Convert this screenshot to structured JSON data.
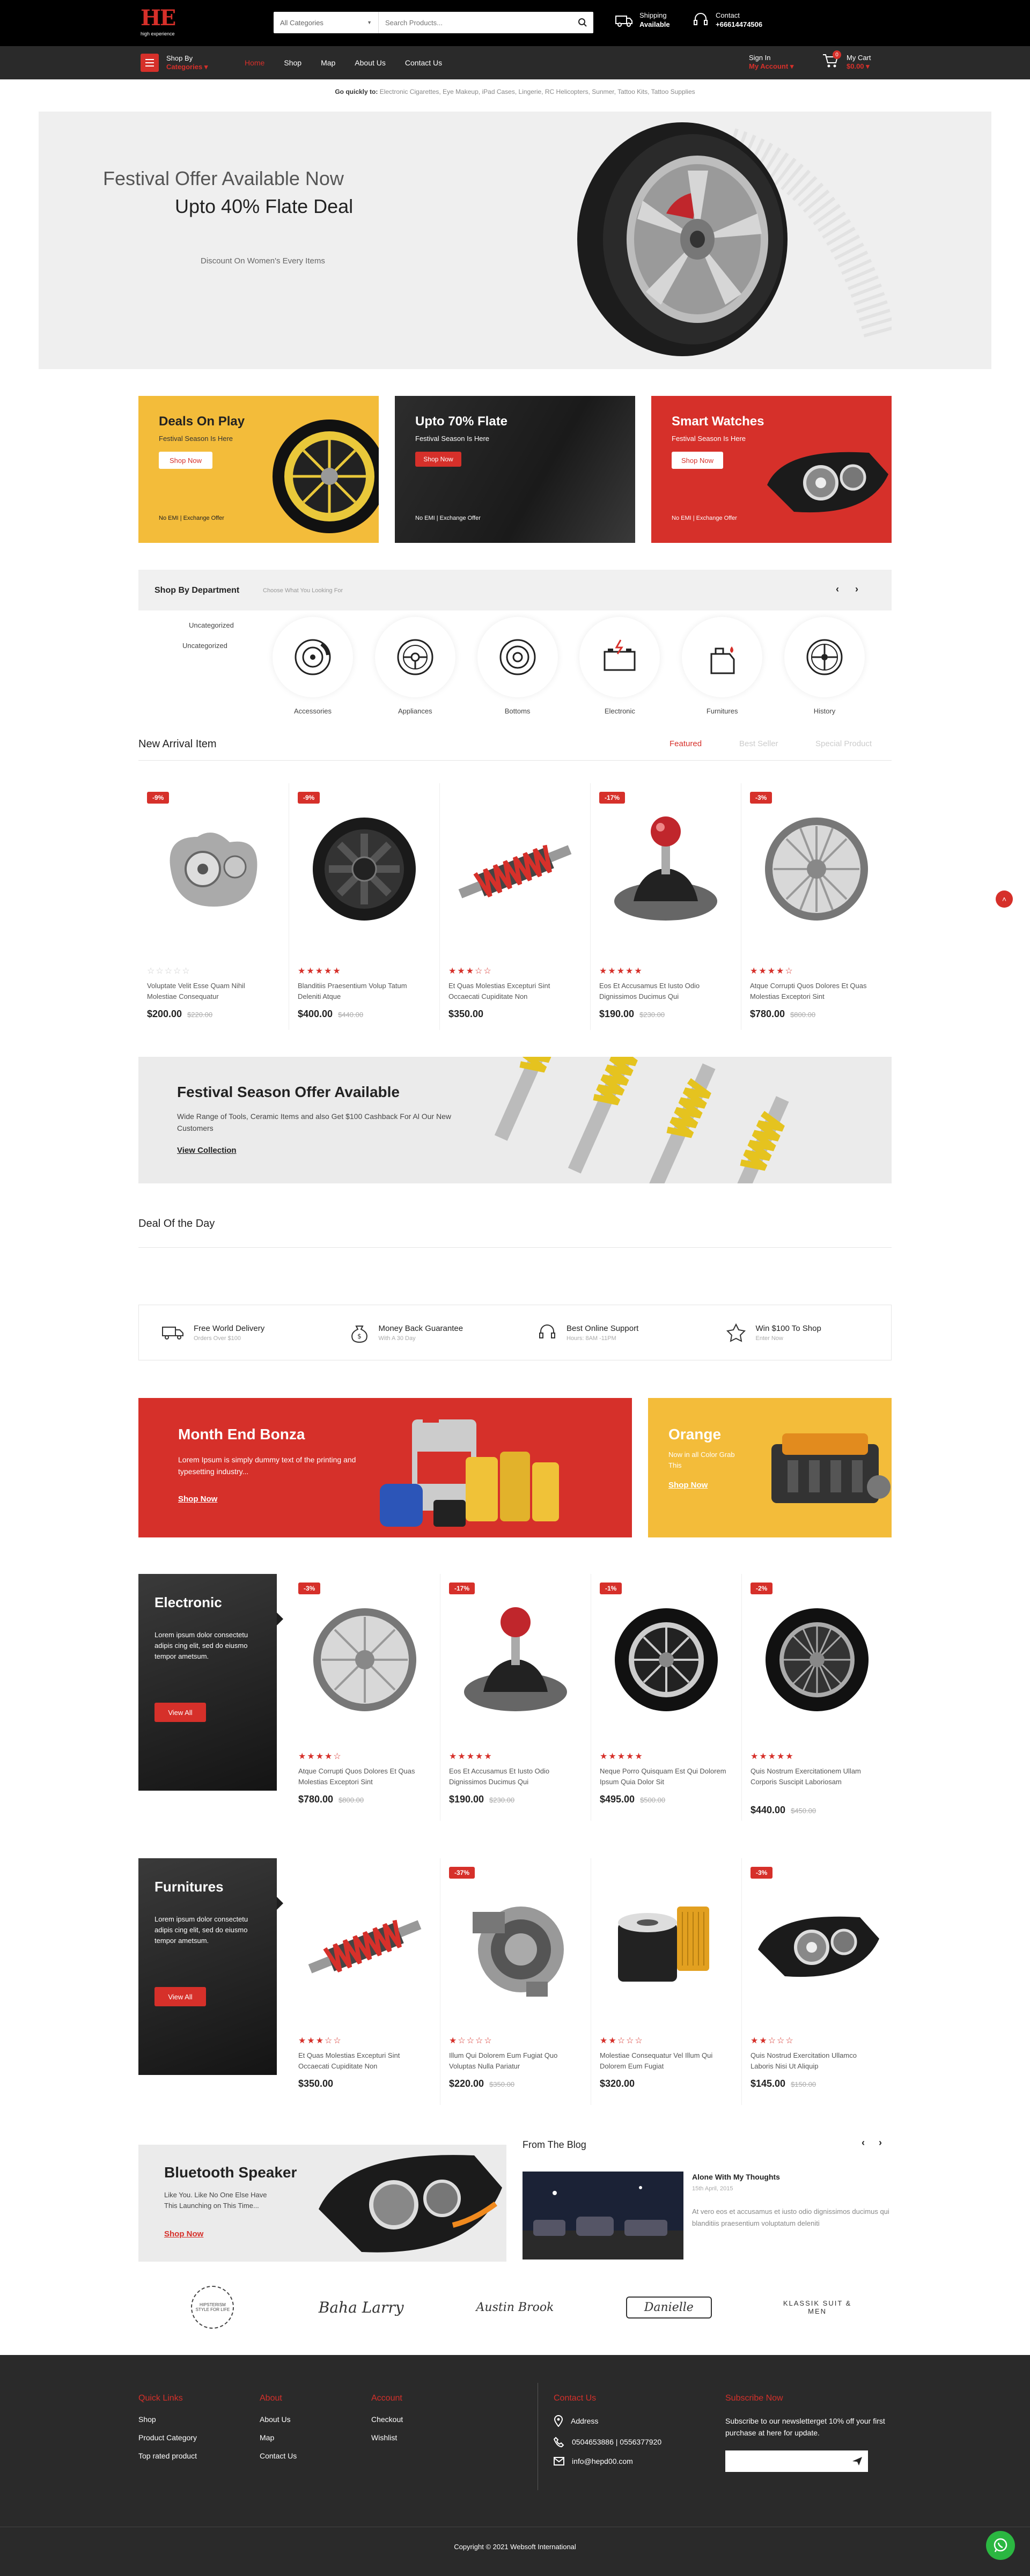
{
  "header": {
    "logo_text": "HE",
    "logo_sub": "high experience",
    "category_select": "All Categories",
    "search_placeholder": "Search Products...",
    "shipping_title": "Shipping",
    "shipping_sub": "Available",
    "contact_title": "Contact",
    "contact_phone": "+66614474506"
  },
  "nav": {
    "shop_by": "Shop By",
    "categories": "Categories",
    "links": [
      "Home",
      "Shop",
      "Map",
      "About Us",
      "Contact Us"
    ],
    "signin": "Sign In",
    "my_account": "My Account",
    "cart_title": "My Cart",
    "cart_total": "$0.00",
    "cart_count": "0"
  },
  "quick_links": {
    "label": "Go quickly to:",
    "items": [
      "Electronic Cigarettes,",
      "Eye Makeup,",
      "iPad Cases,",
      "Lingerie,",
      "RC Helicopters,",
      "Sunmer,",
      "Tattoo Kits,",
      "Tattoo Supplies"
    ]
  },
  "hero": {
    "line1": "Festival Offer Available Now",
    "line2": "Upto 40% Flate Deal",
    "line3": "Discount On Women's Every Items"
  },
  "promos": [
    {
      "title": "Deals On Play",
      "sub": "Festival Season Is Here",
      "button": "Shop Now",
      "foot": "No EMI | Exchange Offer"
    },
    {
      "title": "Upto 70% Flate",
      "sub": "Festival Season Is Here",
      "button": "Shop Now",
      "foot": "No EMI | Exchange Offer"
    },
    {
      "title": "Smart Watches",
      "sub": "Festival Season Is Here",
      "button": "Shop Now",
      "foot": "No EMI | Exchange Offer"
    }
  ],
  "department": {
    "title": "Shop By Department",
    "sub": "Choose What You Looking For",
    "sub_items": [
      "Uncategorized",
      "Uncategorized"
    ],
    "cats": [
      "Accessories",
      "Appliances",
      "Bottoms",
      "Electronic",
      "Furnitures",
      "History"
    ]
  },
  "arrivals": {
    "title": "New Arrival Item",
    "tabs": [
      "Featured",
      "Best Seller",
      "Special Product"
    ],
    "products": [
      {
        "badge": "-9%",
        "name": "Voluptate Velit Esse Quam Nihil Molestiae Consequatur",
        "price": "$200.00",
        "old": "$220.00",
        "stars": "☆☆☆☆☆"
      },
      {
        "badge": "-9%",
        "name": "Blanditiis Praesentium Volup Tatum Deleniti Atque",
        "price": "$400.00",
        "old": "$440.00",
        "stars": "★★★★★"
      },
      {
        "badge": "",
        "name": "Et Quas Molestias Excepturi Sint Occaecati Cupiditate Non",
        "price": "$350.00",
        "old": "",
        "stars": "★★★☆☆"
      },
      {
        "badge": "-17%",
        "name": "Eos Et Accusamus Et Iusto Odio Dignissimos Ducimus Qui",
        "price": "$190.00",
        "old": "$230.00",
        "stars": "★★★★★"
      },
      {
        "badge": "-3%",
        "name": "Atque Corrupti Quos Dolores Et Quas Molestias Exceptori Sint",
        "price": "$780.00",
        "old": "$800.00",
        "stars": "★★★★☆"
      }
    ]
  },
  "festival": {
    "title": "Festival Season Offer Available",
    "text": "Wide Range of Tools, Ceramic Items and also Get $100 Cashback For Al Our New Customers",
    "link": "View Collection"
  },
  "deal_title": "Deal Of the Day",
  "features": [
    {
      "title": "Free World Delivery",
      "sub": "Orders Over $100"
    },
    {
      "title": "Money Back Guarantee",
      "sub": "With A 30 Day"
    },
    {
      "title": "Best Online Support",
      "sub": "Hours: 8AM -11PM"
    },
    {
      "title": "Win $100 To Shop",
      "sub": "Enter Now"
    }
  ],
  "bonza": {
    "title": "Month End Bonza",
    "text": "Lorem Ipsum is simply dummy text of the printing and typesetting industry...",
    "link": "Shop Now"
  },
  "orange": {
    "title": "Orange",
    "text": "Now in all Color Grab This",
    "link": "Shop Now"
  },
  "electronic": {
    "title": "Electronic",
    "text": "Lorem ipsum dolor consectetu adipis cing elit, sed do eiusmo tempor ametsum.",
    "button": "View All",
    "products": [
      {
        "badge": "-3%",
        "name": "Atque Corrupti Quos Dolores Et Quas Molestias Exceptori Sint",
        "price": "$780.00",
        "old": "$800.00",
        "stars": "★★★★☆"
      },
      {
        "badge": "-17%",
        "name": "Eos Et Accusamus Et Iusto Odio Dignissimos Ducimus Qui",
        "price": "$190.00",
        "old": "$230.00",
        "stars": "★★★★★"
      },
      {
        "badge": "-1%",
        "name": "Neque Porro Quisquam Est Qui Dolorem Ipsum Quia Dolor Sit",
        "price": "$495.00",
        "old": "$500.00",
        "stars": "★★★★★"
      },
      {
        "badge": "-2%",
        "name": "Quis Nostrum Exercitationem Ullam Corporis Suscipit Laboriosam",
        "price": "$440.00",
        "old": "$450.00",
        "stars": "★★★★★"
      }
    ]
  },
  "furnitures": {
    "title": "Furnitures",
    "text": "Lorem ipsum dolor consectetu adipis cing elit, sed do eiusmo tempor ametsum.",
    "button": "View All",
    "products": [
      {
        "badge": "",
        "name": "Et Quas Molestias Excepturi Sint Occaecati Cupiditate Non",
        "price": "$350.00",
        "old": "",
        "stars": "★★★☆☆"
      },
      {
        "badge": "-37%",
        "name": "Illum Qui Dolorem Eum Fugiat Quo Voluptas Nulla Pariatur",
        "price": "$220.00",
        "old": "$350.00",
        "stars": "★☆☆☆☆"
      },
      {
        "badge": "",
        "name": "Molestiae Consequatur Vel Illum Qui Dolorem Eum Fugiat",
        "price": "$320.00",
        "old": "",
        "stars": "★★☆☆☆"
      },
      {
        "badge": "-3%",
        "name": "Quis Nostrud Exercitation Ullamco Laboris Nisi Ut Aliquip",
        "price": "$145.00",
        "old": "$150.00",
        "stars": "★★☆☆☆"
      }
    ]
  },
  "speaker": {
    "title": "Bluetooth Speaker",
    "text": "Like You. Like No One Else Have This Launching on This Time...",
    "link": "Shop Now"
  },
  "blog": {
    "title": "From The Blog",
    "post_title": "Alone With My Thoughts",
    "post_date": "15th April, 2015",
    "post_text": "At vero eos et accusamus et iusto odio dignissimos ducimus qui blanditiis praesentium voluptatum deleniti"
  },
  "brands": [
    "HIPSTERISM STYLE FOR LIFE",
    "Baha Larry",
    "Austin Brook",
    "Danielle",
    "KLASSIK SUIT & MEN"
  ],
  "footer": {
    "quick_title": "Quick Links",
    "quick": [
      "Shop",
      "Product Category",
      "Top rated product"
    ],
    "about_title": "About",
    "about": [
      "About Us",
      "Map",
      "Contact Us"
    ],
    "account_title": "Account",
    "account": [
      "Checkout",
      "Wishlist"
    ],
    "contact_title": "Contact Us",
    "address": "Address",
    "phone": "0504653886 | 0556377920",
    "email": "info@hepd00.com",
    "subscribe_title": "Subscribe Now",
    "subscribe_text": "Subscribe to our newsletterget 10% off your first purchase at here for update.",
    "copyright": "Copyright © 2021 Websoft International"
  },
  "colors": {
    "accent": "#d6302a",
    "yellow": "#f3bc3a",
    "dark": "#2a2a2a"
  }
}
